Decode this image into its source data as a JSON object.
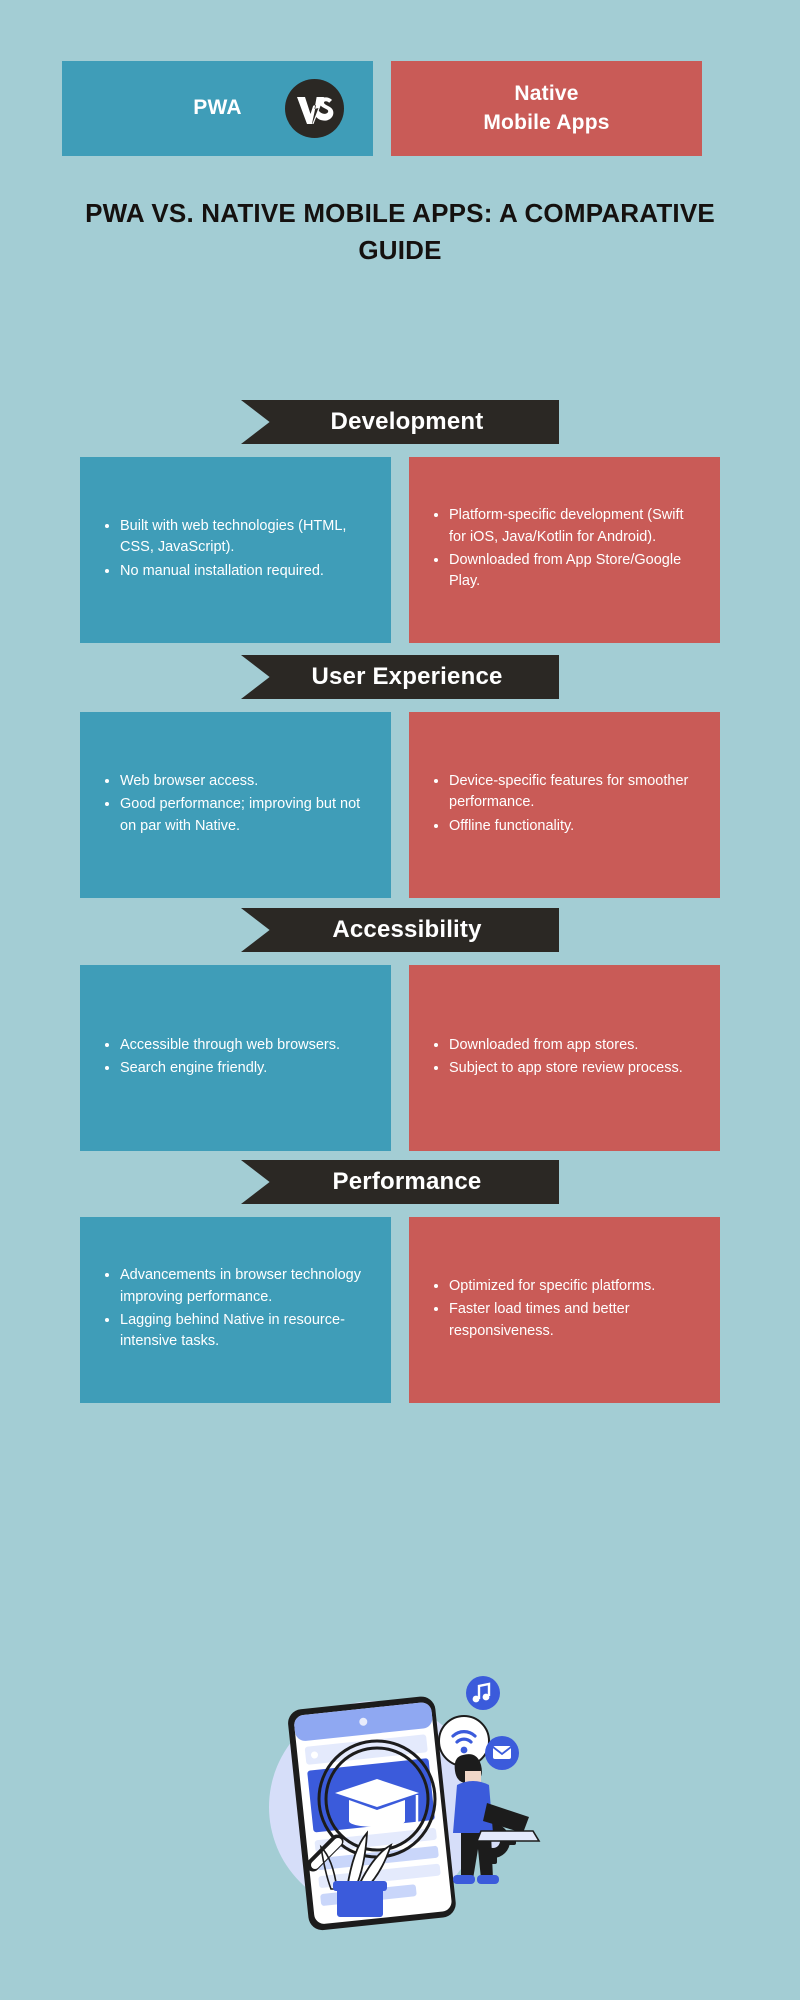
{
  "colors": {
    "background": "#a3cdd4",
    "pwa": "#3f9db8",
    "native": "#c95b57",
    "banner": "#2b2824",
    "text_light": "#ffffff",
    "text_dark": "#15110f"
  },
  "header": {
    "left_label": "PWA",
    "right_label": "Native\nMobile Apps",
    "right_line1": "Native",
    "right_line2": "Mobile Apps",
    "vs_label": "VS"
  },
  "title": "PWA VS. NATIVE MOBILE APPS: A COMPARATIVE GUIDE",
  "sections": [
    {
      "banner": "Development",
      "pwa": [
        "Built with web technologies (HTML, CSS, JavaScript).",
        "No manual installation required."
      ],
      "native": [
        "Platform-specific development (Swift for iOS, Java/Kotlin for Android).",
        "Downloaded from App Store/Google Play."
      ]
    },
    {
      "banner": "User Experience",
      "pwa": [
        "Web browser access.",
        "Good performance; improving but not on par with Native."
      ],
      "native": [
        "Device-specific features for smoother performance.",
        "Offline functionality."
      ]
    },
    {
      "banner": "Accessibility",
      "pwa": [
        "Accessible through web browsers.",
        "Search engine friendly."
      ],
      "native": [
        "Downloaded from app stores.",
        "Subject to app store review process."
      ]
    },
    {
      "banner": "Performance",
      "pwa": [
        "Advancements in browser technology improving performance.",
        "Lagging behind Native in resource-intensive tasks."
      ],
      "native": [
        "Optimized for specific platforms.",
        "Faster load times and better responsiveness."
      ]
    }
  ],
  "illustration": {
    "icons": [
      "wifi-icon",
      "music-note-icon",
      "envelope-icon",
      "graduation-cap-icon",
      "magnifier-icon",
      "gear-icon"
    ],
    "description": "person with laptop beside a large smartphone showing a graduation cap under a magnifying glass"
  }
}
